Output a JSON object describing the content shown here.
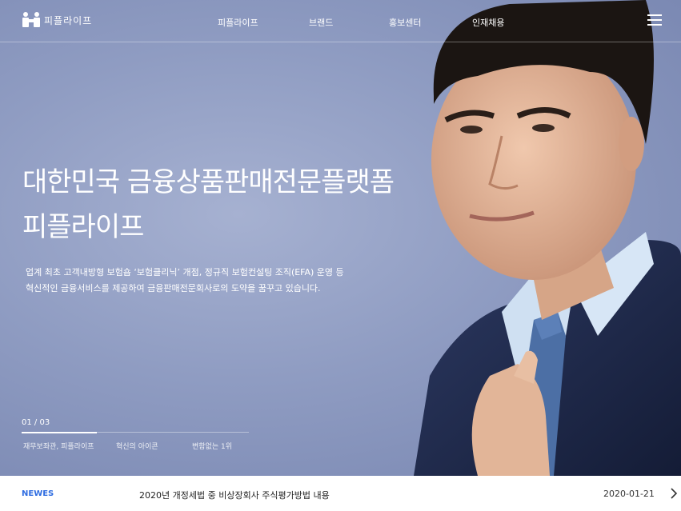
{
  "brand": {
    "name": "피플라이프"
  },
  "nav": [
    {
      "label": "피플라이프"
    },
    {
      "label": "브랜드"
    },
    {
      "label": "홍보센터"
    },
    {
      "label": "인재채용"
    }
  ],
  "hero": {
    "title_line1": "대한민국 금융상품판매전문플랫폼",
    "title_line2": "피플라이프",
    "desc_line1": "업계 최초 고객내방형 보험숍 ‘보험클리닉’ 개점, 정규직 보험컨설팅 조직(EFA) 운영 등",
    "desc_line2": "혁신적인 금융서비스를 제공하여 금융판매전문회사로의 도약을 꿈꾸고 있습니다.",
    "pager": "01 / 03",
    "progress": 0.33,
    "slides": [
      {
        "label": "재무보좌관, 피플라이프"
      },
      {
        "label": "혁신의 아이콘"
      },
      {
        "label": "변함없는 1위"
      }
    ]
  },
  "news": {
    "label": "NEWES",
    "headline": "2020년 개정세법 중 비상장회사 주식평가방법 내용",
    "date": "2020-01-21"
  },
  "colors": {
    "accent": "#2f6de1",
    "hero_bg": "#8f9cc2",
    "suit": "#1f2b4e"
  },
  "icons": {
    "logo": "people-logo-icon",
    "menu": "hamburger-menu-icon",
    "next": "chevron-right-icon"
  }
}
